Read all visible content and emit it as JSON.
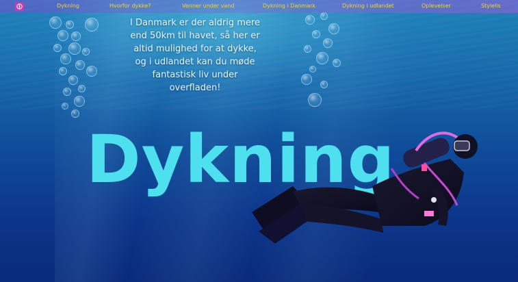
{
  "nav": {
    "items": [
      {
        "label": "Dykning"
      },
      {
        "label": "Hvorfor dykke?"
      },
      {
        "label": "Venner under vand"
      },
      {
        "label": "Dykning i Danmark"
      },
      {
        "label": "Dykning i udlandet"
      },
      {
        "label": "Oplevelser"
      },
      {
        "label": "Stylelis"
      }
    ]
  },
  "intro": {
    "lines": [
      "I Danmark er der aldrig mere",
      "end 50km til havet, så her er",
      "altid mulighed for at dykke,",
      "og i udlandet kan du møde",
      "fantastisk liv under",
      "overfladen!"
    ]
  },
  "headline": "Dykning",
  "colors": {
    "nav_text": "#f2d23a",
    "headline": "#4ee0ef",
    "intro_text": "#e8f6ff",
    "logo": "#c43bb8"
  }
}
